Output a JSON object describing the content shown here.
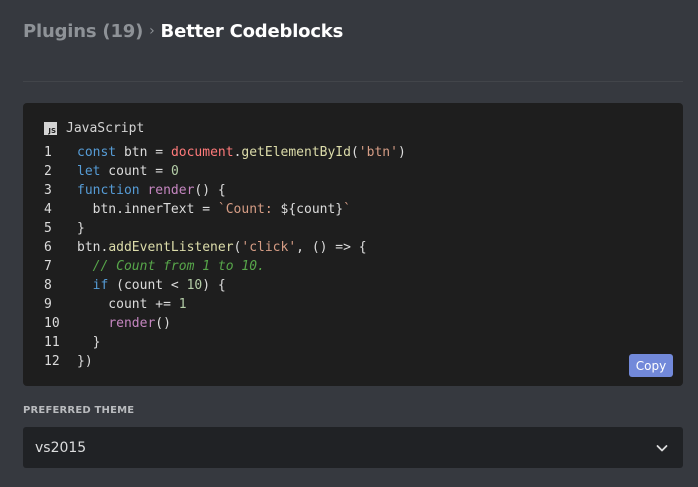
{
  "breadcrumb": {
    "parent": "Plugins (19)",
    "separator": "›",
    "current": "Better Codeblocks"
  },
  "code_block": {
    "language_icon": "JS",
    "language": "JavaScript",
    "copy_label": "Copy",
    "line_numbers": [
      "1",
      "2",
      "3",
      "4",
      "5",
      "6",
      "7",
      "8",
      "9",
      "10",
      "11",
      "12"
    ],
    "lines": [
      "const btn = document.getElementById('btn')",
      "let count = 0",
      "function render() {",
      "  btn.innerText = `Count: ${count}`",
      "}",
      "btn.addEventListener('click', () => {",
      "  // Count from 1 to 10.",
      "  if (count < 10) {",
      "    count += 1",
      "    render()",
      "  }",
      "})"
    ]
  },
  "theme": {
    "label": "PREFERRED THEME",
    "selected": "vs2015"
  },
  "colors": {
    "background": "#36393f",
    "code_background": "#1e1e1e",
    "accent": "#7289da",
    "select_background": "#202225"
  }
}
